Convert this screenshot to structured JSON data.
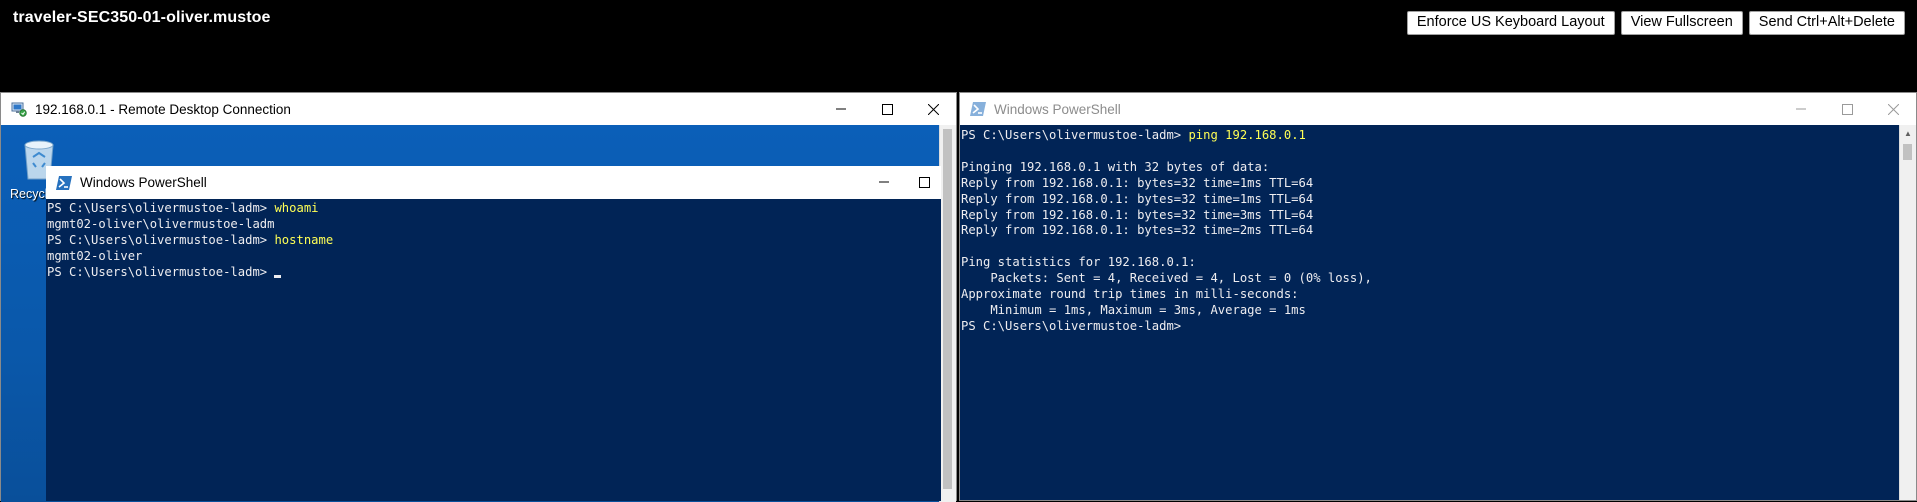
{
  "session": {
    "title": "traveler-SEC350-01-oliver.mustoe",
    "buttons": [
      {
        "label": "Enforce US Keyboard Layout"
      },
      {
        "label": "View Fullscreen"
      },
      {
        "label": "Send Ctrl+Alt+Delete"
      }
    ]
  },
  "rdp_window": {
    "title": "192.168.0.1 - Remote Desktop Connection",
    "desktop": {
      "recycle_bin_label": "Recycl"
    },
    "inner_powershell": {
      "title": "Windows PowerShell",
      "lines": [
        {
          "prompt": "PS C:\\Users\\olivermustoe-ladm> ",
          "command": "whoami"
        },
        {
          "output": "mgmt02-oliver\\olivermustoe-ladm"
        },
        {
          "prompt": "PS C:\\Users\\olivermustoe-ladm> ",
          "command": "hostname"
        },
        {
          "output": "mgmt02-oliver"
        },
        {
          "prompt": "PS C:\\Users\\olivermustoe-ladm> ",
          "command": ""
        }
      ]
    }
  },
  "right_powershell": {
    "title": "Windows PowerShell",
    "first_prompt": "PS C:\\Users\\olivermustoe-ladm> ",
    "first_command": "ping 192.168.0.1",
    "output": "\nPinging 192.168.0.1 with 32 bytes of data:\nReply from 192.168.0.1: bytes=32 time=1ms TTL=64\nReply from 192.168.0.1: bytes=32 time=1ms TTL=64\nReply from 192.168.0.1: bytes=32 time=3ms TTL=64\nReply from 192.168.0.1: bytes=32 time=2ms TTL=64\n\nPing statistics for 192.168.0.1:\n    Packets: Sent = 4, Received = 4, Lost = 0 (0% loss),\nApproximate round trip times in milli-seconds:\n    Minimum = 1ms, Maximum = 3ms, Average = 1ms\nPS C:\\Users\\olivermustoe-ladm>"
  },
  "colors": {
    "terminal_bg": "#012456",
    "command_yellow": "#ffff55",
    "desktop_blue": "#0a58aa"
  }
}
